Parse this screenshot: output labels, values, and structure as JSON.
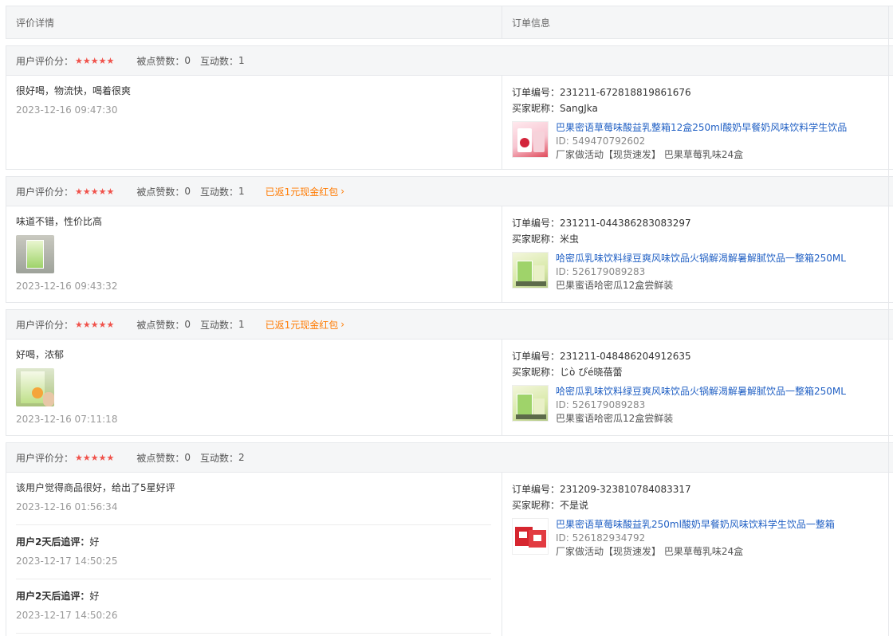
{
  "header": {
    "left": "评价详情",
    "right": "订单信息"
  },
  "labels": {
    "rating": "用户评价分：",
    "likes": "被点赞数：",
    "interactions": "互动数：",
    "order_no": "订单编号：",
    "buyer": "买家昵称："
  },
  "stars": "★★★★★",
  "cards": [
    {
      "likes": "0",
      "interactions": "1",
      "cashback": "",
      "review": "很好喝，物流快，喝着很爽",
      "time": "2023-12-16 09:47:30",
      "order_no": "231211-672818819861676",
      "buyer": "SangJka",
      "product_title": "巴果密语草莓味酸益乳整箱12盒250ml酸奶早餐奶风味饮料学生饮品",
      "product_id": "ID: 549470792602",
      "product_spec": "厂家做活动【现货速发】 巴果草莓乳味24盒"
    },
    {
      "likes": "0",
      "interactions": "1",
      "cashback": "已返1元现金红包",
      "review": "味道不错，性价比高",
      "time": "2023-12-16 09:43:32",
      "order_no": "231211-044386283083297",
      "buyer": "米虫",
      "product_title": "哈密瓜乳味饮料绿豆爽风味饮品火锅解渴解暑解腻饮品一整箱250ML",
      "product_id": "ID: 526179089283",
      "product_spec": "巴果蜜语哈密瓜12盒尝鲜装"
    },
    {
      "likes": "0",
      "interactions": "1",
      "cashback": "已返1元现金红包",
      "review": "好喝，浓郁",
      "time": "2023-12-16 07:11:18",
      "order_no": "231211-048486204912635",
      "buyer": "じò ぴé晓蓓蕾",
      "product_title": "哈密瓜乳味饮料绿豆爽风味饮品火锅解渴解暑解腻饮品一整箱250ML",
      "product_id": "ID: 526179089283",
      "product_spec": "巴果蜜语哈密瓜12盒尝鲜装"
    },
    {
      "likes": "0",
      "interactions": "2",
      "cashback": "",
      "review": "该用户觉得商品很好，给出了5星好评",
      "time": "2023-12-16 01:56:34",
      "order_no": "231209-323810784083317",
      "buyer": "不是说",
      "product_title": "巴果密语草莓味酸益乳250ml酸奶早餐奶风味饮料学生饮品一整箱",
      "product_id": "ID: 526182934792",
      "product_spec": "厂家做活动【现货速发】 巴果草莓乳味24盒",
      "followups": [
        {
          "label": "用户2天后追评：",
          "text": "好",
          "time": "2023-12-17 14:50:25"
        },
        {
          "label": "用户2天后追评：",
          "text": "好",
          "time": "2023-12-17 14:50:26"
        }
      ]
    }
  ]
}
